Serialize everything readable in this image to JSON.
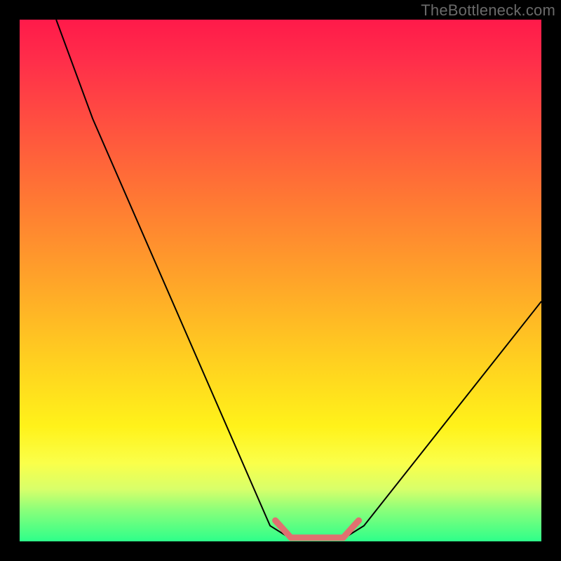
{
  "watermark": "TheBottleneck.com",
  "chart_data": {
    "type": "line",
    "title": "",
    "xlabel": "",
    "ylabel": "",
    "xlim": [
      0,
      100
    ],
    "ylim": [
      0,
      100
    ],
    "grid": false,
    "series": [
      {
        "name": "black-v-curve",
        "stroke": "#000000",
        "stroke_width": 2,
        "points": [
          {
            "x": 7,
            "y": 100
          },
          {
            "x": 14,
            "y": 81
          },
          {
            "x": 48,
            "y": 3
          },
          {
            "x": 52,
            "y": 0.5
          },
          {
            "x": 62,
            "y": 0.5
          },
          {
            "x": 66,
            "y": 3
          },
          {
            "x": 100,
            "y": 46
          }
        ]
      },
      {
        "name": "pink-bottom-trace",
        "stroke": "#e07070",
        "stroke_width": 9,
        "points": [
          {
            "x": 49,
            "y": 4
          },
          {
            "x": 52,
            "y": 0.7
          },
          {
            "x": 62,
            "y": 0.7
          },
          {
            "x": 65,
            "y": 4
          }
        ]
      }
    ],
    "gradient_stops": [
      {
        "pos": 0,
        "color": "#ff1a4a"
      },
      {
        "pos": 8,
        "color": "#ff2e4a"
      },
      {
        "pos": 20,
        "color": "#ff5040"
      },
      {
        "pos": 35,
        "color": "#ff7a33"
      },
      {
        "pos": 50,
        "color": "#ffa429"
      },
      {
        "pos": 65,
        "color": "#ffcf20"
      },
      {
        "pos": 78,
        "color": "#fff21a"
      },
      {
        "pos": 85,
        "color": "#faff4a"
      },
      {
        "pos": 90,
        "color": "#d8ff6a"
      },
      {
        "pos": 94,
        "color": "#8aff7a"
      },
      {
        "pos": 100,
        "color": "#2eff8a"
      }
    ]
  }
}
